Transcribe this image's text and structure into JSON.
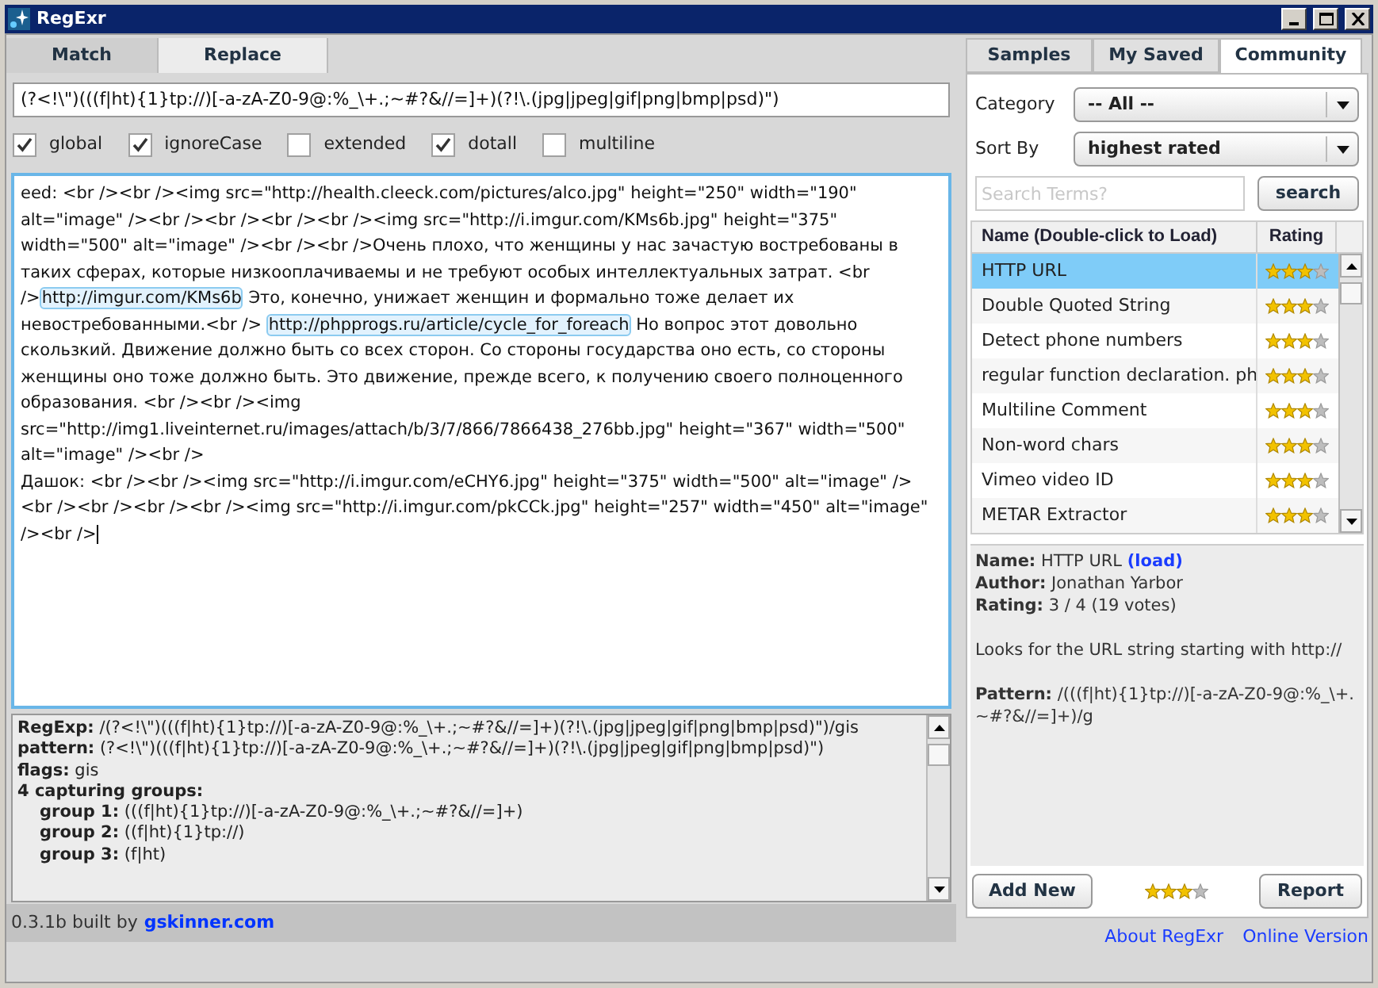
{
  "window": {
    "title": "RegExr"
  },
  "mode_tabs": [
    {
      "label": "Match",
      "selected": true
    },
    {
      "label": "Replace",
      "selected": false
    }
  ],
  "pattern": {
    "value": "(?<!\\\")(((f|ht){1}tp://)[-a-zA-Z0-9@:%_\\+.;~#?&//=]+)(?!\\.(jpg|jpeg|gif|png|bmp|psd)\")"
  },
  "flags": [
    {
      "label": "global",
      "checked": true
    },
    {
      "label": "ignoreCase",
      "checked": true
    },
    {
      "label": "extended",
      "checked": false
    },
    {
      "label": "dotall",
      "checked": true
    },
    {
      "label": "multiline",
      "checked": false
    }
  ],
  "source": [
    {
      "kind": "text",
      "text": "eed: <br /><br /><img src=\"http://health.cleeck.com/pictures/alco.jpg\" height=\"250\" width=\"190\" alt=\"image\" /><br /><br /><br /><br /><img src=\"http://i.imgur.com/KMs6b.jpg\" height=\"375\" width=\"500\" alt=\"image\" /><br /><br />Очень плохо, что женщины у нас зачастую востребованы в таких сферах, которые низкооплачиваемы и не требуют особых интеллектуальных затрат. <br />"
    },
    {
      "kind": "match",
      "text": "http://imgur.com/KMs6b"
    },
    {
      "kind": "text",
      "text": " Это, конечно, унижает женщин и формально тоже делает их невостребованными.<br /> "
    },
    {
      "kind": "match",
      "text": "http://phpprogs.ru/article/cycle_for_foreach"
    },
    {
      "kind": "text",
      "text": " Но вопрос этот довольно скользкий. Движение должно быть со всех сторон. Со стороны государства оно есть, со стороны женщины оно тоже должно быть. Это движение, прежде всего, к получению своего полноценного образования. <br /><br /><img src=\"http://img1.liveinternet.ru/images/attach/b/3/7/866/7866438_276bb.jpg\" height=\"367\" width=\"500\" alt=\"image\" /><br />\nДашок: <br /><br /><img src=\"http://i.imgur.com/eCHY6.jpg\" height=\"375\" width=\"500\" alt=\"image\" /><br /><br /><br /><br /><img src=\"http://i.imgur.com/pkCCk.jpg\" height=\"257\" width=\"450\" alt=\"image\" /><br />"
    }
  ],
  "results": [
    {
      "text": "**RegExp:** /(?<!\\\")(((f|ht){1}tp://)[-a-zA-Z0-9@:%_\\+.;~#?&//=]+)(?!\\.(jpg|jpeg|gif|png|bmp|psd)\")/gis"
    },
    {
      "text": "**pattern:** (?<!\\\")(((f|ht){1}tp://)[-a-zA-Z0-9@:%_\\+.;~#?&//=]+)(?!\\.(jpg|jpeg|gif|png|bmp|psd)\")"
    },
    {
      "text": "**flags:** gis"
    },
    {
      "text": "**4 capturing groups:**",
      "children": [
        {
          "text": "**group 1:** (((f|ht){1}tp://)[-a-zA-Z0-9@:%_\\+.;~#?&//=]+)"
        },
        {
          "text": "**group 2:** ((f|ht){1}tp://)"
        },
        {
          "text": "**group 3:** (f|ht)"
        }
      ]
    }
  ],
  "footer": {
    "version": "0.3.1b built by",
    "link": "gskinner.com",
    "links": [
      "About RegExr",
      "Online Version"
    ]
  },
  "side_tabs": [
    {
      "label": "Samples",
      "selected": false
    },
    {
      "label": "My Saved",
      "selected": false
    },
    {
      "label": "Community",
      "selected": true
    }
  ],
  "filters": [
    {
      "label": "Category",
      "value": "-- All --"
    },
    {
      "label": "Sort By",
      "value": "highest rated"
    }
  ],
  "search": {
    "placeholder": "Search Terms?",
    "button": "search"
  },
  "table": {
    "columns": [
      "Name (Double-click to Load)",
      "Rating"
    ],
    "rows": [
      {
        "name": "HTTP URL",
        "stars": 3,
        "selected": true
      },
      {
        "name": "Double Quoted String",
        "stars": 3,
        "selected": false
      },
      {
        "name": "Detect phone numbers",
        "stars": 3,
        "selected": false
      },
      {
        "name": "regular function declaration. ph",
        "stars": 3,
        "selected": false
      },
      {
        "name": "Multiline Comment",
        "stars": 3,
        "selected": false
      },
      {
        "name": "Non-word chars",
        "stars": 3,
        "selected": false
      },
      {
        "name": "Vimeo video ID",
        "stars": 3,
        "selected": false
      },
      {
        "name": "METAR Extractor",
        "stars": 3,
        "selected": false
      }
    ]
  },
  "details": {
    "name_label": "Name:",
    "name": "HTTP URL",
    "load": "(load)",
    "author_label": "Author:",
    "author": "Jonathan Yarbor",
    "rating_label": "Rating:",
    "rating": "3 / 4 (19 votes)",
    "description": "Looks for the URL string starting with http://",
    "pattern_label": "Pattern:",
    "pattern": "/(((f|ht){1}tp://)[-a-zA-Z0-9@:%_\\+.~#?&//=]+)/g"
  },
  "actions": {
    "add": "Add New",
    "stars": 3,
    "report": "Report"
  }
}
